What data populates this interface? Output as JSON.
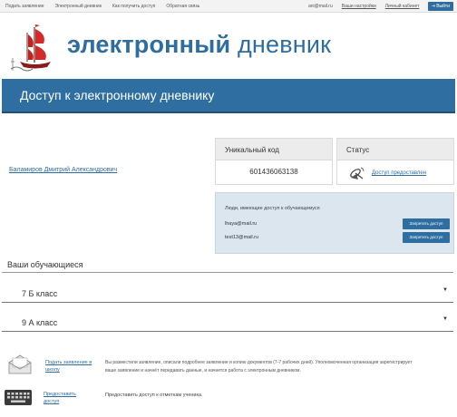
{
  "topbar": {
    "nav": [
      "Подать заявление",
      "Электронный дневник",
      "Как получить доступ",
      "Обратная связь"
    ],
    "user_email": "ani@mail.ru",
    "links": [
      "Ваши настройки",
      "Личный кабинет"
    ],
    "exit_label": "Выйти"
  },
  "brand": {
    "word1": "электронный",
    "word2": "дневник",
    "logo_icon": "sailing-ship-icon"
  },
  "banner": {
    "title": "Доступ к электронному дневнику"
  },
  "student": {
    "name": "Баламиров Дмитрий Александрович",
    "code_header": "Уникальный код",
    "code_value": "601436063138",
    "status_header": "Статус",
    "status_icon": "satellite-icon",
    "status_link": "Доступ предоставлен"
  },
  "access": {
    "title": "Люди, имеющие доступ к обучающемуся",
    "rows": [
      {
        "email": "lhaya@mail.ru",
        "button": "Запретить доступ"
      },
      {
        "email": "test13@mail.ru",
        "button": "Запретить доступ"
      }
    ]
  },
  "students_section": {
    "title": "Ваши обучающиеся",
    "classes": [
      "7 Б класс",
      "9 А класс"
    ]
  },
  "info": {
    "row1": {
      "icon": "envelope-icon",
      "link": "Подать заявление в школу",
      "text": "Вы разместили заявление, описали подробнее заявление и копию документов (7-7 рабочих дней). Уполномоченная организация зарегистрирует ваше заявление и начнёт передавать данные, и начнется работа с электронным дневником."
    },
    "row2": {
      "icon": "keyboard-icon",
      "link": "Предоставить доступ",
      "text": "Предоставить доступ к отметкам ученика."
    }
  },
  "colors": {
    "accent": "#2e6ea0",
    "link": "#2f6d9e",
    "panel_bg": "#dbe6ee"
  }
}
